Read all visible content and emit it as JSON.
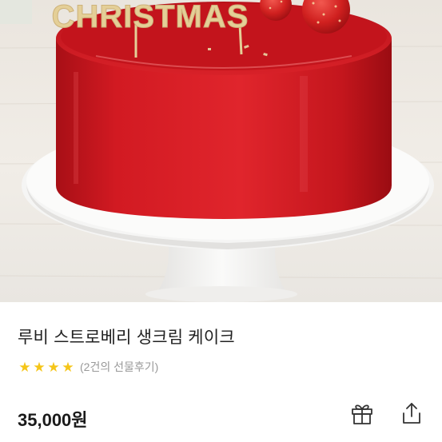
{
  "hero": {
    "banner_text": "CHRISTMAS",
    "colors": {
      "cake_red": "#d21a22",
      "topper_gold": "#e4cf97",
      "stand_white": "#f7f7f6"
    }
  },
  "product": {
    "title": "루비 스트로베리 생크림 케이크",
    "rating": {
      "stars": 4,
      "max_stars": 4,
      "review_text": "(2건의 선물후기)"
    },
    "price": "35,000원"
  },
  "actions": {
    "gift_icon": "gift-icon",
    "share_icon": "share-icon"
  },
  "colors": {
    "star": "#f5c518",
    "muted_text": "#999999",
    "title_text": "#222222"
  }
}
